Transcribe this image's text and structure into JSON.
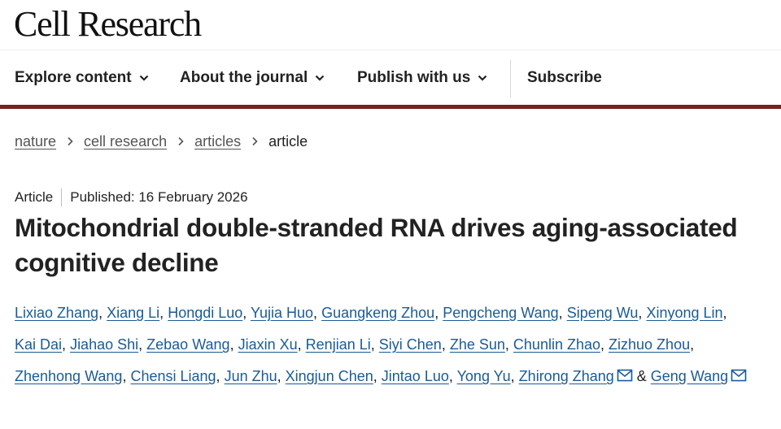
{
  "header": {
    "journal_title": "Cell Research"
  },
  "nav": {
    "explore": "Explore content",
    "about": "About the journal",
    "publish": "Publish with us",
    "subscribe": "Subscribe"
  },
  "breadcrumb": [
    "nature",
    "cell research",
    "articles",
    "article"
  ],
  "article": {
    "type": "Article",
    "published": "Published: 16 February 2026",
    "title": "Mitochondrial double-stranded RNA drives aging-associated cognitive decline",
    "authors": [
      "Lixiao Zhang",
      "Xiang Li",
      "Hongdi Luo",
      "Yujia Huo",
      "Guangkeng Zhou",
      "Pengcheng Wang",
      "Sipeng Wu",
      "Xinyong Lin",
      "Kai Dai",
      "Jiahao Shi",
      "Zebao Wang",
      "Jiaxin Xu",
      "Renjian Li",
      "Siyi Chen",
      "Zhe Sun",
      "Chunlin Zhao",
      "Zizhuo Zhou",
      "Zhenhong Wang",
      "Chensi Liang",
      "Jun Zhu",
      "Xingjun Chen",
      "Jintao Luo",
      "Yong Yu",
      "Zhirong Zhang",
      "Geng Wang"
    ],
    "author_separator": ", ",
    "author_final_separator": " & "
  },
  "icons": {
    "corresponding": "mail-icon",
    "dropdown": "chevron-down-icon",
    "breadcrumb_sep": "chevron-right-icon"
  },
  "colors": {
    "accent_rule": "#7a1f1f",
    "link": "#1a5b96",
    "text": "#222222"
  }
}
